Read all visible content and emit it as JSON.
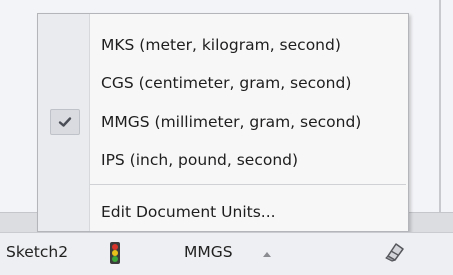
{
  "units_menu": {
    "items": [
      {
        "label": "MKS (meter, kilogram, second)",
        "checked": false
      },
      {
        "label": "CGS (centimeter, gram, second)",
        "checked": false
      },
      {
        "label": "MMGS (millimeter, gram, second)",
        "checked": true
      },
      {
        "label": "IPS (inch, pound, second)",
        "checked": false
      }
    ],
    "edit_label": "Edit Document Units..."
  },
  "statusbar": {
    "sketch_name": "Sketch2",
    "units": "MMGS",
    "icons": [
      "traffic-light-icon",
      "up-arrow-icon",
      "eraser-icon"
    ]
  },
  "colors": {
    "menu_background": "#f7f7f8",
    "gutter": "#eaebee",
    "checked_box": "#d9dbe0",
    "traffic_red": "#d8342a",
    "traffic_yellow": "#e8c21a",
    "traffic_green": "#3aa63a"
  }
}
